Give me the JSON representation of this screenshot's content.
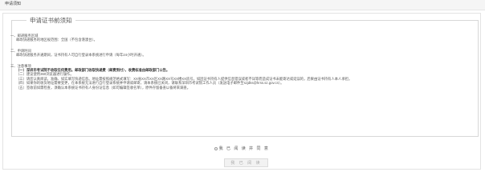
{
  "header": {
    "title": "申请须知"
  },
  "notice": {
    "title": "申请证书前须知",
    "sections": [
      {
        "heading": "一、邮递服务区域",
        "lines": [
          "邮政快递服务的地区规范围：全国（不包含港澳台）。"
        ]
      },
      {
        "heading": "二、申请时间",
        "lines": [
          "邮政快递服务开通期间，证书持有人可自行登录本系统进行申请（每年24小时开通）。"
        ]
      },
      {
        "heading": "三、注意事项",
        "lines": [
          "（一）深圳市考试院不收取任何费用。邮政部门收取快递费（邮费到付），收费标准由邮政部门公告。",
          "（二）建议使用360浏览器进行操作。",
          "（三）请您认真阅读，准确、如实填写快递信息。地址需按照规范格式填写：XX省XX市XX区XX路XX号XX楼XX房号。如因证书持有人提供信息错误或者不详等而造成证书未能寄达或延误的，后果由证书持有人本人承担。",
          "（四）如果你的收货地址需要变更，在本系统无法进行自行登录系统并申请或邮寄，请本系统已关闭，请联系深圳市考试院工作人员（发送电子邮件至szjdks@hrss.sz.gov.cn）。",
          "（五）签收前如需检查，须确认本系统证书持有人身份证信息（如可编辑签收名单），原件存留备查以备将来调查。"
        ]
      }
    ]
  },
  "agreement": {
    "label": "我 已 阅 读 并 同 意"
  },
  "confirm": {
    "label": "我 已 阅 读"
  },
  "colors": {
    "accent_red": "#d9534f",
    "border": "#d7d7d7"
  }
}
